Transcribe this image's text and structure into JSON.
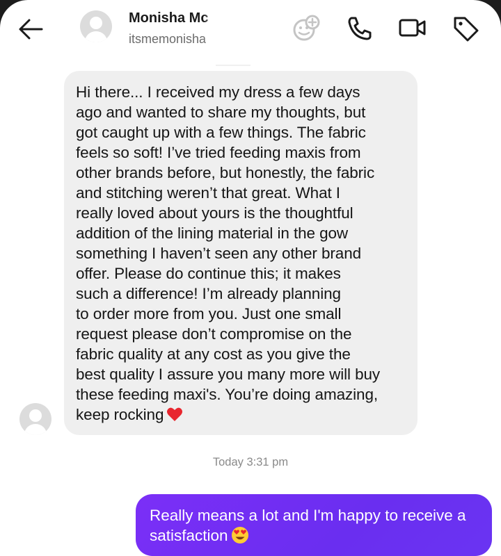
{
  "header": {
    "contact_name": "Monisha Mc",
    "contact_handle": "itsmemonisha"
  },
  "icons": {
    "back": "arrow-left-icon",
    "sticker": "sticker-add-icon",
    "call": "phone-icon",
    "video": "video-camera-icon",
    "tag": "tag-icon"
  },
  "messages": {
    "incoming": {
      "lines": [
        "Hi there... I received my dress a few days",
        "ago and wanted to share my thoughts, but",
        "got caught up with a few things. The fabric",
        "feels so soft! I’ve tried feeding maxis from",
        "other brands before, but honestly, the fabric",
        "and stitching weren’t that great. What I",
        "really loved about yours is the thoughtful",
        "addition of the lining material in the gow",
        "something I haven’t seen any other brand",
        "offer. Please do continue this; it makes",
        "such a difference! I’m already planning",
        "to order more from you. Just one small",
        "request please don’t compromise on the",
        "fabric quality at any cost as you give the",
        "best quality I assure you many more will buy",
        "these feeding maxi's. You’re doing amazing,",
        "keep rocking"
      ],
      "emoji": "red-heart"
    },
    "timestamp": "Today 3:31 pm",
    "outgoing": {
      "lines": [
        "Really means a lot and I'm happy to receive a",
        "satisfaction"
      ],
      "emoji": "heart-eyes"
    }
  },
  "colors": {
    "incoming_bubble": "#efefef",
    "outgoing_bubble": "#7b2ff7",
    "heart": "#e8262e",
    "timestamp": "#8a8a8a"
  }
}
